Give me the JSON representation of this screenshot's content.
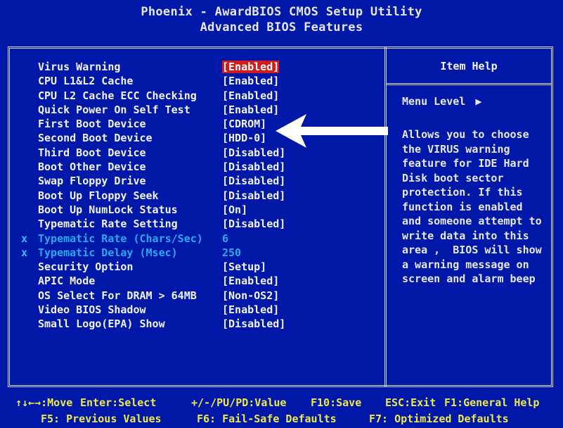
{
  "header": {
    "title": "Phoenix - AwardBIOS CMOS Setup Utility",
    "subtitle": "Advanced BIOS Features"
  },
  "settings": [
    {
      "label": "Virus Warning",
      "value": "[Enabled]",
      "selected": true,
      "disabled": false
    },
    {
      "label": "CPU L1&L2 Cache",
      "value": "[Enabled]",
      "selected": false,
      "disabled": false
    },
    {
      "label": "CPU L2 Cache ECC Checking",
      "value": "[Enabled]",
      "selected": false,
      "disabled": false
    },
    {
      "label": "Quick Power On Self Test",
      "value": "[Enabled]",
      "selected": false,
      "disabled": false
    },
    {
      "label": "First Boot Device",
      "value": "[CDROM]",
      "selected": false,
      "disabled": false
    },
    {
      "label": "Second Boot Device",
      "value": "[HDD-0]",
      "selected": false,
      "disabled": false
    },
    {
      "label": "Third Boot Device",
      "value": "[Disabled]",
      "selected": false,
      "disabled": false
    },
    {
      "label": "Boot Other Device",
      "value": "[Disabled]",
      "selected": false,
      "disabled": false
    },
    {
      "label": "Swap Floppy Drive",
      "value": "[Disabled]",
      "selected": false,
      "disabled": false
    },
    {
      "label": "Boot Up Floppy Seek",
      "value": "[Disabled]",
      "selected": false,
      "disabled": false
    },
    {
      "label": "Boot Up NumLock Status",
      "value": "[On]",
      "selected": false,
      "disabled": false
    },
    {
      "label": "Typematic Rate Setting",
      "value": "[Disabled]",
      "selected": false,
      "disabled": false
    },
    {
      "label": "Typematic Rate (Chars/Sec)",
      "value": "6",
      "selected": false,
      "disabled": true,
      "mark": "x"
    },
    {
      "label": "Typematic Delay (Msec)",
      "value": "250",
      "selected": false,
      "disabled": true,
      "mark": "x"
    },
    {
      "label": "Security Option",
      "value": "[Setup]",
      "selected": false,
      "disabled": false
    },
    {
      "label": "APIC Mode",
      "value": "[Enabled]",
      "selected": false,
      "disabled": false
    },
    {
      "label": "OS Select For DRAM > 64MB",
      "value": "[Non-OS2]",
      "selected": false,
      "disabled": false
    },
    {
      "label": "Video BIOS Shadow",
      "value": "[Enabled]",
      "selected": false,
      "disabled": false
    },
    {
      "label": "Small Logo(EPA) Show",
      "value": "[Disabled]",
      "selected": false,
      "disabled": false
    }
  ],
  "help": {
    "title": "Item Help",
    "menu_level_label": "Menu Level",
    "menu_level_arrow": "▶",
    "text_lines": [
      "Allows you to choose",
      "the VIRUS warning",
      "feature for IDE Hard",
      "Disk boot sector",
      "protection. If this",
      "function is enabled",
      "and someone attempt to",
      "write data into this",
      "area ,  BIOS will show",
      "a warning message on",
      "screen and alarm beep"
    ]
  },
  "footer": {
    "line1": [
      {
        "text": "↑↓←→:Move"
      },
      {
        "text": "Enter:Select"
      },
      {
        "text": "+/-/PU/PD:Value"
      },
      {
        "text": "F10:Save"
      },
      {
        "text": "ESC:Exit"
      },
      {
        "text": "F1:General Help"
      }
    ],
    "line2": [
      {
        "text": "F5: Previous Values"
      },
      {
        "text": "F6: Fail-Safe Defaults"
      },
      {
        "text": "F7: Optimized Defaults"
      }
    ]
  },
  "colors": {
    "background": "#0018a8",
    "text": "#f2f2f8",
    "disabled_text": "#2aa8f0",
    "highlight": "#d21c1c",
    "footer_text": "#f0e84a",
    "annotation_arrow": "#ffffff"
  }
}
